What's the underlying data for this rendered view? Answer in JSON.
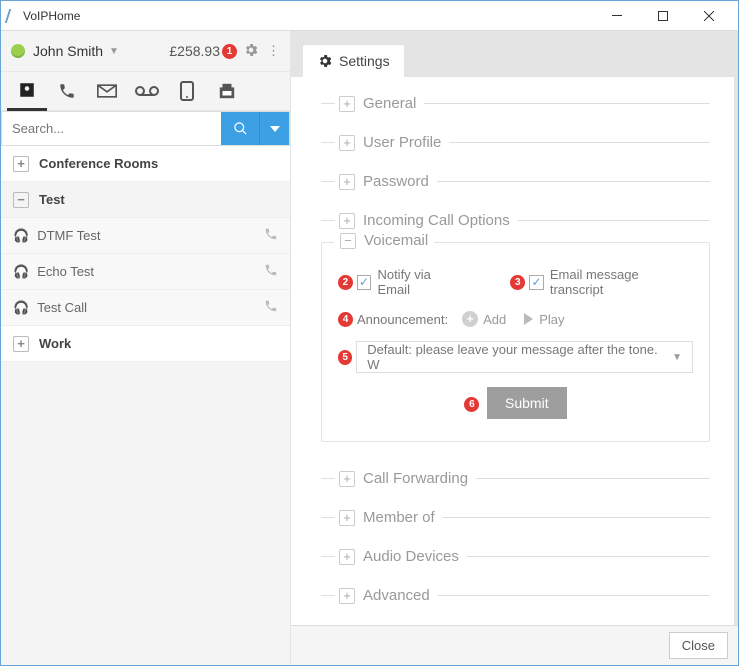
{
  "window": {
    "title": "VoIPHome"
  },
  "user": {
    "name": "John Smith",
    "balance": "£258.93"
  },
  "search": {
    "placeholder": "Search..."
  },
  "sidebar": {
    "groups": [
      {
        "label": "Conference Rooms",
        "expanded": false
      },
      {
        "label": "Test",
        "expanded": true,
        "items": [
          {
            "label": "DTMF Test"
          },
          {
            "label": "Echo Test"
          },
          {
            "label": "Test Call"
          }
        ]
      },
      {
        "label": "Work",
        "expanded": false
      }
    ]
  },
  "tab": {
    "label": "Settings"
  },
  "sections": {
    "general": "General",
    "profile": "User Profile",
    "password": "Password",
    "incoming": "Incoming Call Options",
    "voicemail": "Voicemail",
    "forwarding": "Call Forwarding",
    "memberof": "Member of",
    "audio": "Audio Devices",
    "advanced": "Advanced"
  },
  "voicemail": {
    "notify_label": "Notify via Email",
    "transcript_label": "Email message transcript",
    "announcement_label": "Announcement:",
    "add_label": "Add",
    "play_label": "Play",
    "dropdown_value": "Default: please leave your message after the tone. W",
    "submit_label": "Submit"
  },
  "footer": {
    "close": "Close"
  },
  "callouts": [
    "1",
    "2",
    "3",
    "4",
    "5",
    "6"
  ]
}
